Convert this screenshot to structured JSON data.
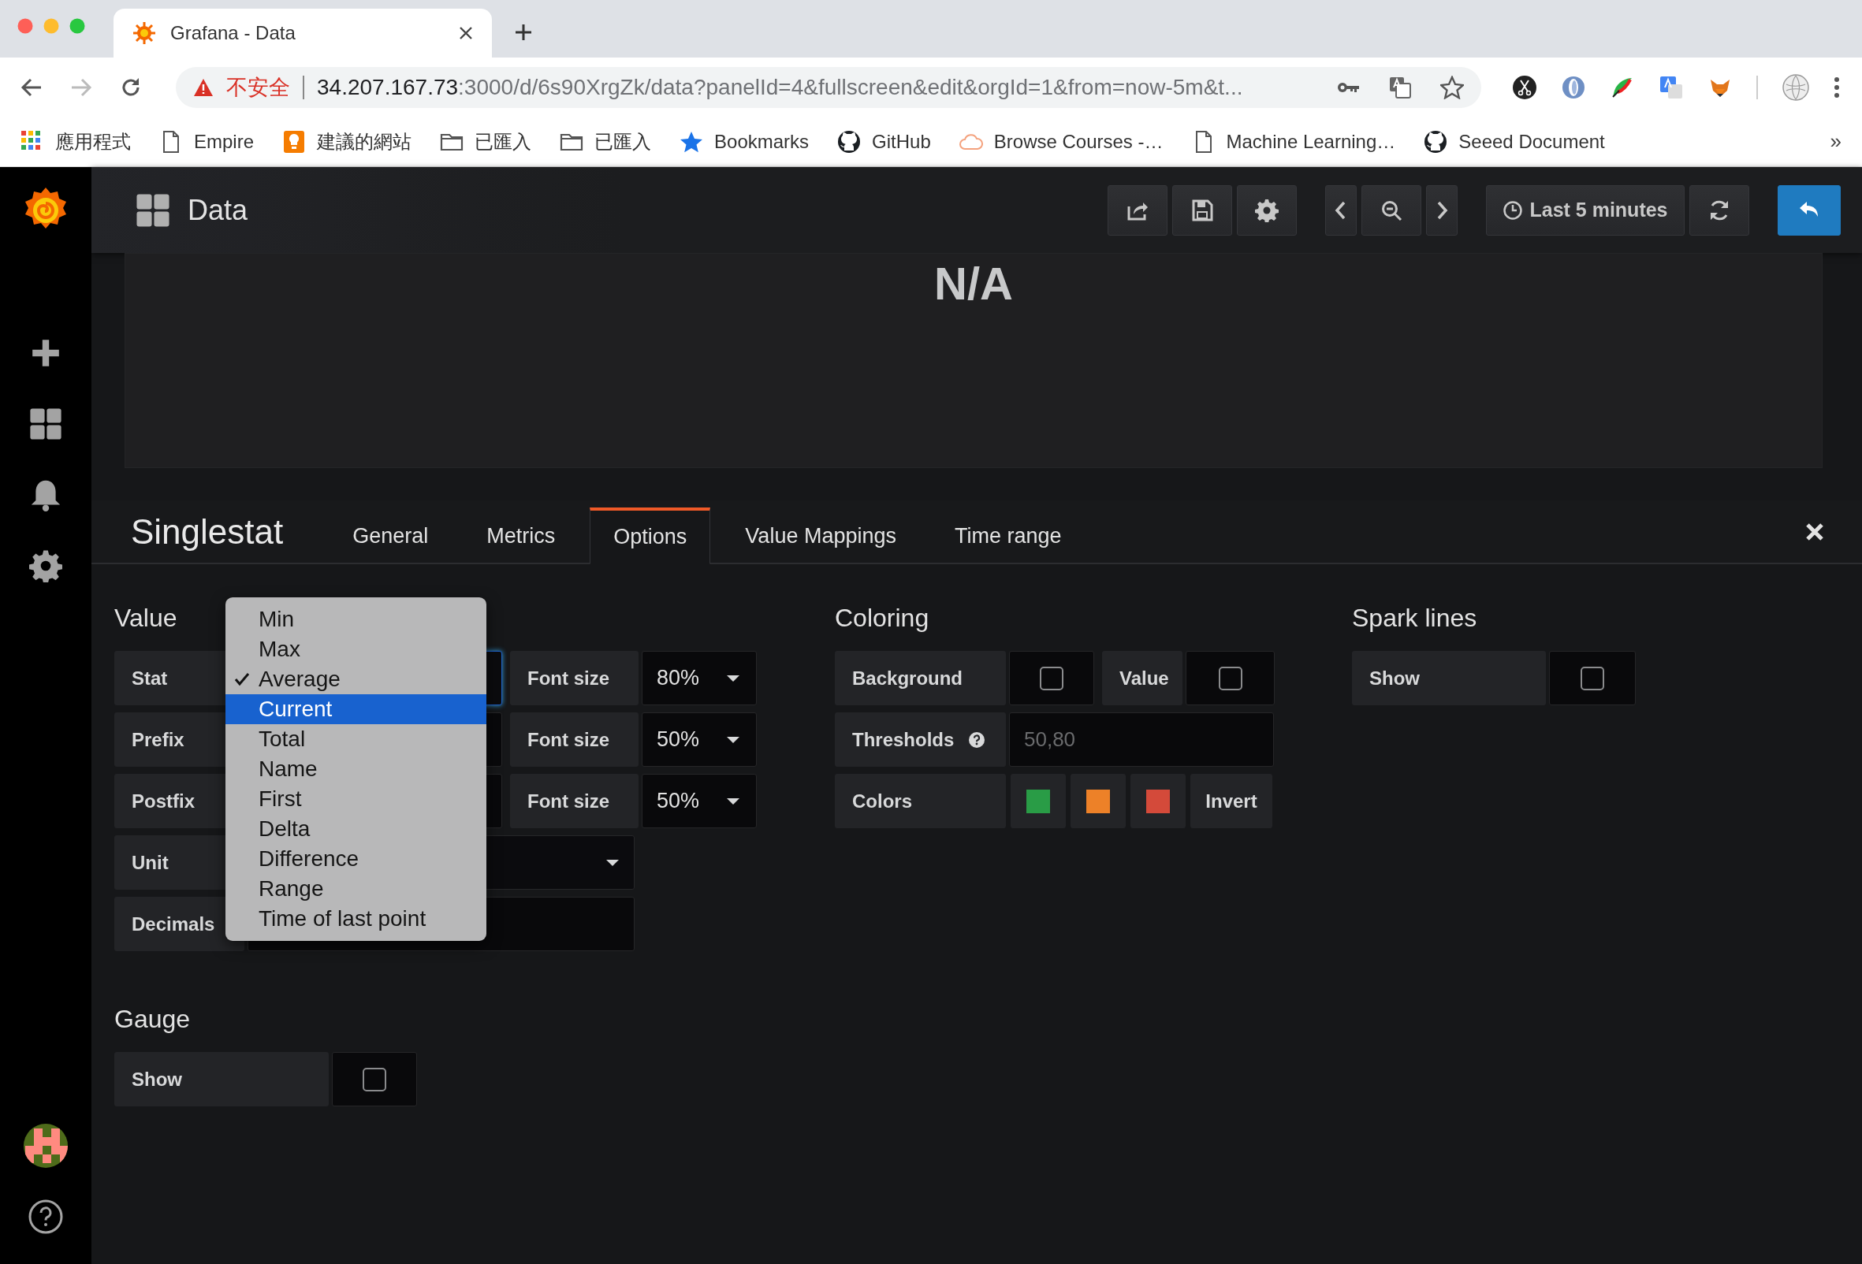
{
  "browser": {
    "tab_title": "Grafana - Data",
    "address": {
      "warning": "不安全",
      "host": "34.207.167.73",
      "path": ":3000/d/6s90XrgZk/data?panelId=4&fullscreen&edit&orgId=1&from=now-5m&t..."
    },
    "bookmarks": [
      {
        "label": "應用程式",
        "kind": "apps"
      },
      {
        "label": "Empire",
        "kind": "page"
      },
      {
        "label": "建議的網站",
        "kind": "bulb"
      },
      {
        "label": "已匯入",
        "kind": "folder"
      },
      {
        "label": "已匯入",
        "kind": "folder"
      },
      {
        "label": "Bookmarks",
        "kind": "star"
      },
      {
        "label": "GitHub",
        "kind": "github"
      },
      {
        "label": "Browse Courses -…",
        "kind": "cloud"
      },
      {
        "label": "Machine Learning…",
        "kind": "page"
      },
      {
        "label": "Seeed Document",
        "kind": "github"
      }
    ],
    "overflow": "»"
  },
  "header": {
    "title": "Data",
    "time_range": "Last 5 minutes"
  },
  "panel": {
    "value": "N/A"
  },
  "editor": {
    "title": "Singlestat",
    "tabs": [
      {
        "label": "General",
        "selected": false
      },
      {
        "label": "Metrics",
        "selected": false
      },
      {
        "label": "Options",
        "selected": true
      },
      {
        "label": "Value Mappings",
        "selected": false
      },
      {
        "label": "Time range",
        "selected": false
      }
    ]
  },
  "value_section": {
    "title": "Value",
    "rows": [
      {
        "label": "Stat",
        "kind": "select",
        "focused": true,
        "font_size": {
          "label": "Font size",
          "value": "80%"
        }
      },
      {
        "label": "Prefix",
        "kind": "input",
        "focused": false,
        "font_size": {
          "label": "Font size",
          "value": "50%"
        }
      },
      {
        "label": "Postfix",
        "kind": "input",
        "focused": false,
        "font_size": {
          "label": "Font size",
          "value": "50%"
        }
      },
      {
        "label": "Unit",
        "kind": "select",
        "focused": false
      },
      {
        "label": "Decimals",
        "kind": "input",
        "focused": false
      }
    ]
  },
  "stat_menu": {
    "options": [
      {
        "label": "Min",
        "checked": false,
        "selected": false
      },
      {
        "label": "Max",
        "checked": false,
        "selected": false
      },
      {
        "label": "Average",
        "checked": true,
        "selected": false
      },
      {
        "label": "Current",
        "checked": false,
        "selected": true
      },
      {
        "label": "Total",
        "checked": false,
        "selected": false
      },
      {
        "label": "Name",
        "checked": false,
        "selected": false
      },
      {
        "label": "First",
        "checked": false,
        "selected": false
      },
      {
        "label": "Delta",
        "checked": false,
        "selected": false
      },
      {
        "label": "Difference",
        "checked": false,
        "selected": false
      },
      {
        "label": "Range",
        "checked": false,
        "selected": false
      },
      {
        "label": "Time of last point",
        "checked": false,
        "selected": false
      }
    ]
  },
  "coloring": {
    "title": "Coloring",
    "background": {
      "label": "Background",
      "checked": false
    },
    "value": {
      "label": "Value",
      "checked": false
    },
    "thresholds": {
      "label": "Thresholds",
      "placeholder": "50,80"
    },
    "colors": {
      "label": "Colors",
      "swatches": [
        {
          "color": "#299c46"
        },
        {
          "color": "#ed8128"
        },
        {
          "color": "#d44a3a"
        }
      ],
      "invert": "Invert"
    }
  },
  "spark_lines": {
    "title": "Spark lines",
    "show": {
      "label": "Show",
      "checked": false
    }
  },
  "gauge": {
    "title": "Gauge",
    "show": {
      "label": "Show",
      "checked": false
    }
  }
}
